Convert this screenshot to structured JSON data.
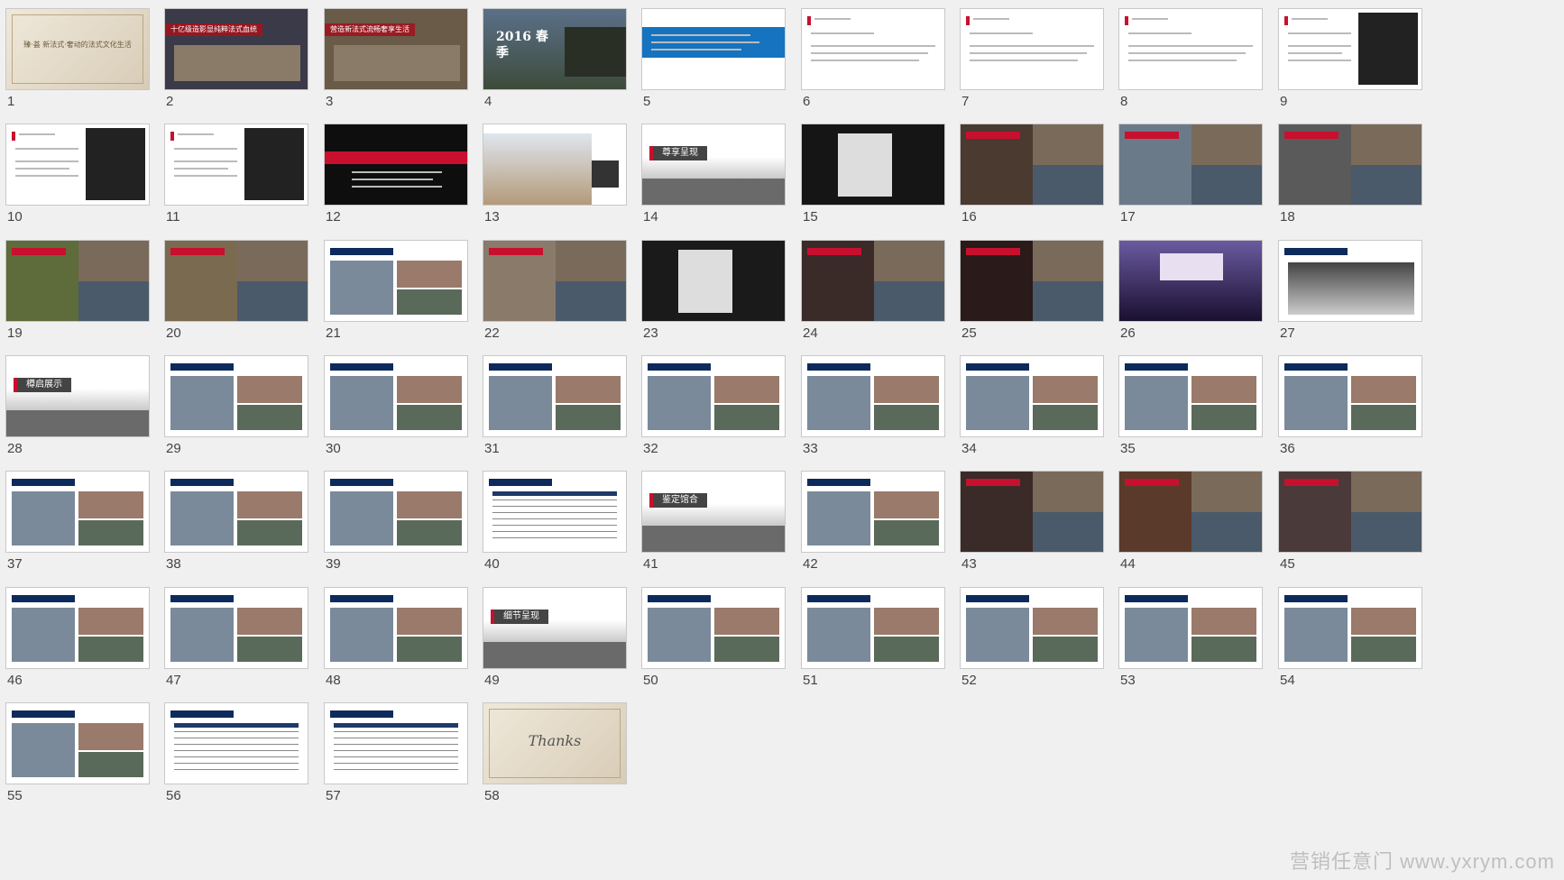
{
  "slides": [
    {
      "n": "1",
      "style": "cover",
      "title": "臻·荟 新法式·奢动的法式文化生活",
      "bg": "#e9e1d3"
    },
    {
      "n": "2",
      "style": "photo-title",
      "title": "十亿级造影显纯粹法式血统",
      "bg": "#3a3a48"
    },
    {
      "n": "3",
      "style": "photo-title",
      "title": "营造新法式流畅奢享生活",
      "bg": "#6a5a48"
    },
    {
      "n": "4",
      "style": "photo-big",
      "title": "2016 春季",
      "bg": "#475a6e"
    },
    {
      "n": "5",
      "style": "blue-band",
      "title": "",
      "bg": "#ffffff"
    },
    {
      "n": "6",
      "style": "text",
      "title": "",
      "bg": "#ffffff"
    },
    {
      "n": "7",
      "style": "text",
      "title": "",
      "bg": "#ffffff"
    },
    {
      "n": "8",
      "style": "text",
      "title": "",
      "bg": "#ffffff"
    },
    {
      "n": "9",
      "style": "text-photo",
      "title": "",
      "bg": "#ffffff"
    },
    {
      "n": "10",
      "style": "text-photo",
      "title": "",
      "bg": "#ffffff"
    },
    {
      "n": "11",
      "style": "text-photo",
      "title": "",
      "bg": "#ffffff"
    },
    {
      "n": "12",
      "style": "black-red",
      "title": "",
      "bg": "#0e0e0e"
    },
    {
      "n": "13",
      "style": "building",
      "title": "",
      "bg": "#ffffff"
    },
    {
      "n": "14",
      "style": "section",
      "title": "尊享呈现",
      "bg": "#9a9a9a"
    },
    {
      "n": "15",
      "style": "dark-photo",
      "title": "",
      "bg": "#151515"
    },
    {
      "n": "16",
      "style": "collage",
      "title": "",
      "bg": "#4a3a30"
    },
    {
      "n": "17",
      "style": "collage",
      "title": "",
      "bg": "#6b7a88"
    },
    {
      "n": "18",
      "style": "collage",
      "title": "",
      "bg": "#5a5a5a"
    },
    {
      "n": "19",
      "style": "collage",
      "title": "",
      "bg": "#5e6b3a"
    },
    {
      "n": "20",
      "style": "collage",
      "title": "",
      "bg": "#7a6a50"
    },
    {
      "n": "21",
      "style": "collage-white",
      "title": "",
      "bg": "#ffffff"
    },
    {
      "n": "22",
      "style": "collage",
      "title": "",
      "bg": "#8a7a6a"
    },
    {
      "n": "23",
      "style": "dark-photo",
      "title": "",
      "bg": "#1a1a1a"
    },
    {
      "n": "24",
      "style": "collage",
      "title": "",
      "bg": "#3a2a28"
    },
    {
      "n": "25",
      "style": "collage",
      "title": "",
      "bg": "#2a1a1a"
    },
    {
      "n": "26",
      "style": "stage",
      "title": "",
      "bg": "#4a3a6a"
    },
    {
      "n": "27",
      "style": "stage-white",
      "title": "",
      "bg": "#ffffff"
    },
    {
      "n": "28",
      "style": "section",
      "title": "樽启展示",
      "bg": "#9a9a9a"
    },
    {
      "n": "29",
      "style": "collage-white",
      "title": "",
      "bg": "#ffffff"
    },
    {
      "n": "30",
      "style": "collage-white",
      "title": "",
      "bg": "#ffffff"
    },
    {
      "n": "31",
      "style": "collage-white",
      "title": "",
      "bg": "#ffffff"
    },
    {
      "n": "32",
      "style": "collage-white",
      "title": "",
      "bg": "#ffffff"
    },
    {
      "n": "33",
      "style": "collage-white",
      "title": "",
      "bg": "#ffffff"
    },
    {
      "n": "34",
      "style": "collage-white",
      "title": "",
      "bg": "#ffffff"
    },
    {
      "n": "35",
      "style": "collage-white",
      "title": "",
      "bg": "#ffffff"
    },
    {
      "n": "36",
      "style": "collage-white",
      "title": "",
      "bg": "#ffffff"
    },
    {
      "n": "37",
      "style": "collage-white",
      "title": "",
      "bg": "#ffffff"
    },
    {
      "n": "38",
      "style": "collage-white",
      "title": "",
      "bg": "#ffffff"
    },
    {
      "n": "39",
      "style": "collage-white",
      "title": "",
      "bg": "#ffffff"
    },
    {
      "n": "40",
      "style": "table",
      "title": "",
      "bg": "#ffffff"
    },
    {
      "n": "41",
      "style": "section",
      "title": "鉴定馆合",
      "bg": "#9a9a9a"
    },
    {
      "n": "42",
      "style": "collage-white",
      "title": "",
      "bg": "#ffffff"
    },
    {
      "n": "43",
      "style": "collage",
      "title": "",
      "bg": "#3a2a28"
    },
    {
      "n": "44",
      "style": "collage",
      "title": "",
      "bg": "#5a3a2a"
    },
    {
      "n": "45",
      "style": "collage",
      "title": "",
      "bg": "#4a3a3a"
    },
    {
      "n": "46",
      "style": "collage-white",
      "title": "",
      "bg": "#ffffff"
    },
    {
      "n": "47",
      "style": "collage-white",
      "title": "",
      "bg": "#ffffff"
    },
    {
      "n": "48",
      "style": "collage-white",
      "title": "",
      "bg": "#ffffff"
    },
    {
      "n": "49",
      "style": "section",
      "title": "细节呈现",
      "bg": "#9a9a9a"
    },
    {
      "n": "50",
      "style": "collage-white",
      "title": "",
      "bg": "#ffffff"
    },
    {
      "n": "51",
      "style": "collage-white",
      "title": "",
      "bg": "#ffffff"
    },
    {
      "n": "52",
      "style": "collage-white",
      "title": "",
      "bg": "#ffffff"
    },
    {
      "n": "53",
      "style": "collage-white",
      "title": "",
      "bg": "#ffffff"
    },
    {
      "n": "54",
      "style": "collage-white",
      "title": "",
      "bg": "#ffffff"
    },
    {
      "n": "55",
      "style": "collage-white",
      "title": "",
      "bg": "#ffffff"
    },
    {
      "n": "56",
      "style": "table",
      "title": "",
      "bg": "#ffffff"
    },
    {
      "n": "57",
      "style": "table",
      "title": "",
      "bg": "#ffffff"
    },
    {
      "n": "58",
      "style": "thanks",
      "title": "Thanks",
      "bg": "#e9e1d3"
    }
  ],
  "watermark": "营销任意门 www.yxrym.com"
}
